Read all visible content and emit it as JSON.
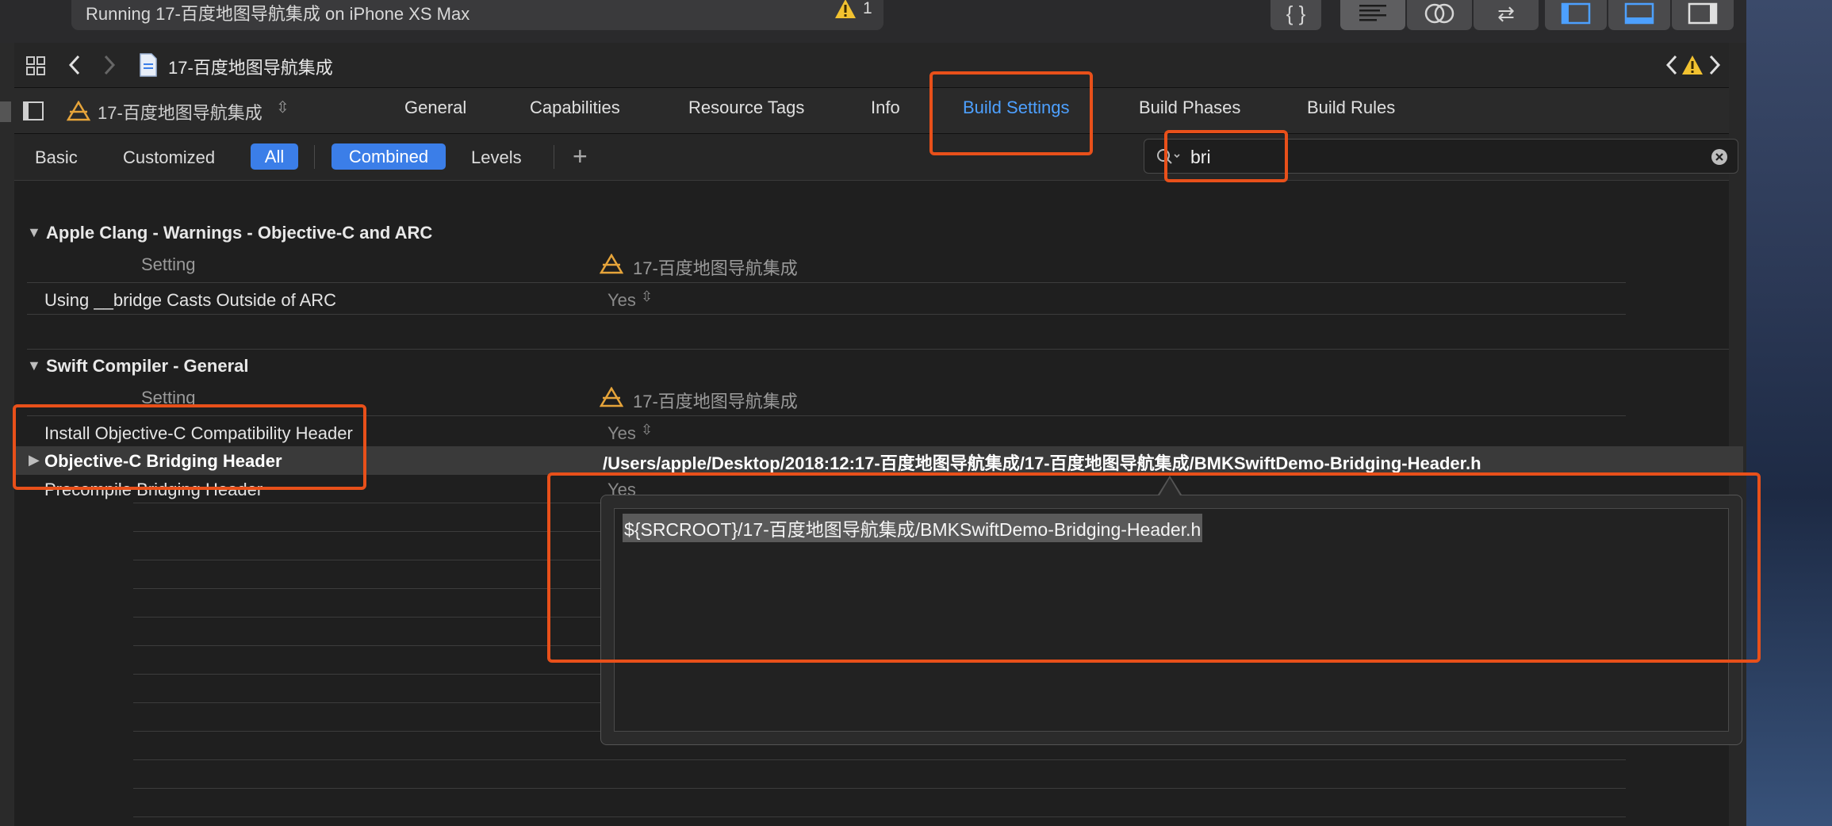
{
  "status": {
    "text": "Running 17-百度地图导航集成 on iPhone XS Max",
    "warning_count": "1"
  },
  "toolbar": {
    "code_review_glyph": "{ }",
    "swap_glyph": "⇄"
  },
  "jumpbar": {
    "file_title": "17-百度地图导航集成"
  },
  "tabbar": {
    "target": "17-百度地图导航集成",
    "tabs": [
      {
        "label": "General"
      },
      {
        "label": "Capabilities"
      },
      {
        "label": "Resource Tags"
      },
      {
        "label": "Info"
      },
      {
        "label": "Build Settings"
      },
      {
        "label": "Build Phases"
      },
      {
        "label": "Build Rules"
      }
    ]
  },
  "filter": {
    "basic": "Basic",
    "customized": "Customized",
    "all": "All",
    "combined": "Combined",
    "levels": "Levels",
    "add_glyph": "+",
    "search_value": "bri"
  },
  "sections": [
    {
      "title": "Apple Clang - Warnings - Objective-C and ARC",
      "setting_header": "Setting",
      "target_header": "17-百度地图导航集成",
      "rows": [
        {
          "name": "Using __bridge Casts Outside of ARC",
          "value": "Yes"
        }
      ]
    },
    {
      "title": "Swift Compiler - General",
      "setting_header": "Setting",
      "target_header": "17-百度地图导航集成",
      "rows": [
        {
          "name": "Install Objective-C Compatibility Header",
          "value": "Yes"
        },
        {
          "name": "Objective-C Bridging Header",
          "value": "/Users/apple/Desktop/2018:12:17-百度地图导航集成/17-百度地图导航集成/BMKSwiftDemo-Bridging-Header.h"
        },
        {
          "name": "Precompile Bridging Header",
          "value": "Yes"
        }
      ]
    }
  ],
  "popover": {
    "text": "${SRCROOT}/17-百度地图导航集成/BMKSwiftDemo-Bridging-Header.h"
  },
  "colors": {
    "accent": "#3b7ee8",
    "active_tab": "#4da0ff",
    "annotation": "#e8501a"
  }
}
